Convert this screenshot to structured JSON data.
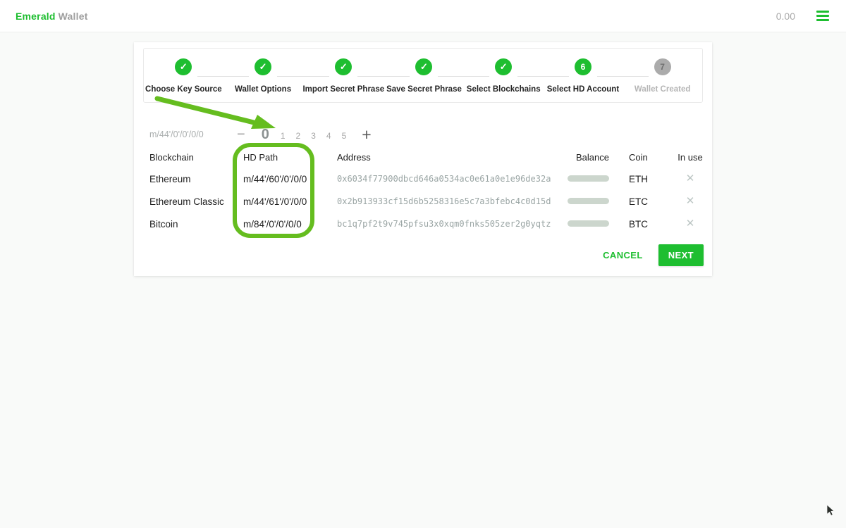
{
  "app": {
    "brand_primary": "Emerald",
    "brand_secondary": "Wallet",
    "total_balance": "0.00"
  },
  "colors": {
    "primary_green": "#1ebe30",
    "annotation_green": "#65bd1f",
    "skeleton_gray": "#ccd6cd"
  },
  "stepper": {
    "steps": [
      {
        "label": "Choose Key Source",
        "state": "completed",
        "icon": "check-icon"
      },
      {
        "label": "Wallet Options",
        "state": "completed",
        "icon": "check-icon"
      },
      {
        "label": "Import Secret Phrase",
        "state": "completed",
        "icon": "check-icon"
      },
      {
        "label": "Save Secret Phrase",
        "state": "completed",
        "icon": "check-icon"
      },
      {
        "label": "Select Blockchains",
        "state": "completed",
        "icon": "check-icon"
      },
      {
        "label": "Select HD Account",
        "state": "active",
        "number": "6"
      },
      {
        "label": "Wallet Created",
        "state": "future",
        "number": "7"
      }
    ],
    "check_glyph": "✓"
  },
  "selector": {
    "base_path": "m/44'/0'/0'/0/0",
    "minus_label": "−",
    "plus_label": "+",
    "indices": [
      "0",
      "1",
      "2",
      "3",
      "4",
      "5"
    ],
    "active_index": "0"
  },
  "table": {
    "headers": {
      "blockchain": "Blockchain",
      "hd_path": "HD Path",
      "address": "Address",
      "balance": "Balance",
      "coin": "Coin",
      "in_use": "In use"
    },
    "rows": [
      {
        "blockchain": "Ethereum",
        "hd_path": "m/44'/60'/0'/0/0",
        "address": "0x6034f77900dbcd646a0534ac0e61a0e1e96de32a",
        "balance": "loading",
        "coin": "ETH",
        "in_use": "✕"
      },
      {
        "blockchain": "Ethereum Classic",
        "hd_path": "m/44'/61'/0'/0/0",
        "address": "0x2b913933cf15d6b5258316e5c7a3bfebc4c0d15d",
        "balance": "loading",
        "coin": "ETC",
        "in_use": "✕"
      },
      {
        "blockchain": "Bitcoin",
        "hd_path": "m/84'/0'/0'/0/0",
        "address": "bc1q7pf2t9v745pfsu3x0xqm0fnks505zer2g0yqtz",
        "balance": "loading",
        "coin": "BTC",
        "in_use": "✕"
      }
    ]
  },
  "footer": {
    "cancel_label": "CANCEL",
    "next_label": "NEXT"
  }
}
